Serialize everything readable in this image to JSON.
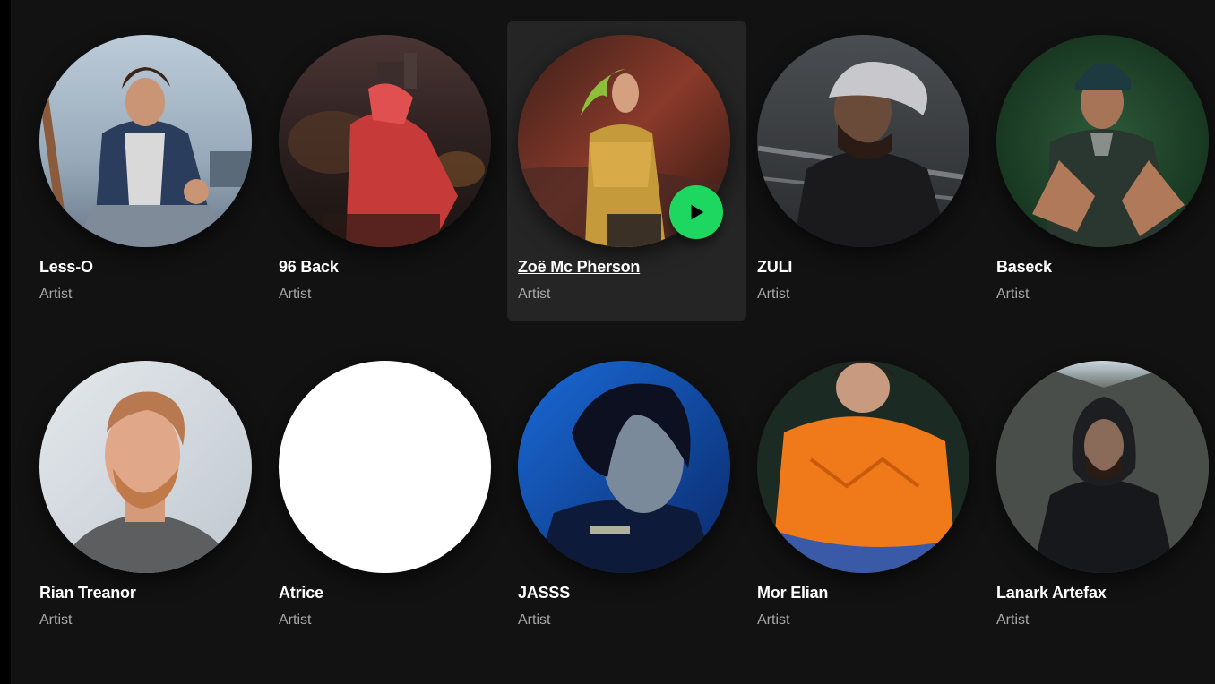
{
  "artists": [
    {
      "name": "Less-O",
      "subtitle": "Artist"
    },
    {
      "name": "96 Back",
      "subtitle": "Artist"
    },
    {
      "name": "Zoë Mc Pherson",
      "subtitle": "Artist",
      "hovered": true
    },
    {
      "name": "ZULI",
      "subtitle": "Artist"
    },
    {
      "name": "Baseck",
      "subtitle": "Artist"
    },
    {
      "name": "Rian Treanor",
      "subtitle": "Artist"
    },
    {
      "name": "Atrice",
      "subtitle": "Artist"
    },
    {
      "name": "JASSS",
      "subtitle": "Artist"
    },
    {
      "name": "Mor Elian",
      "subtitle": "Artist"
    },
    {
      "name": "Lanark Artefax",
      "subtitle": "Artist"
    }
  ],
  "colors": {
    "background": "#121212",
    "card_hover": "#252525",
    "title": "#ffffff",
    "subtitle": "#a7a7a7",
    "play_button": "#1ed760"
  },
  "icons": {
    "play": "play-icon"
  }
}
